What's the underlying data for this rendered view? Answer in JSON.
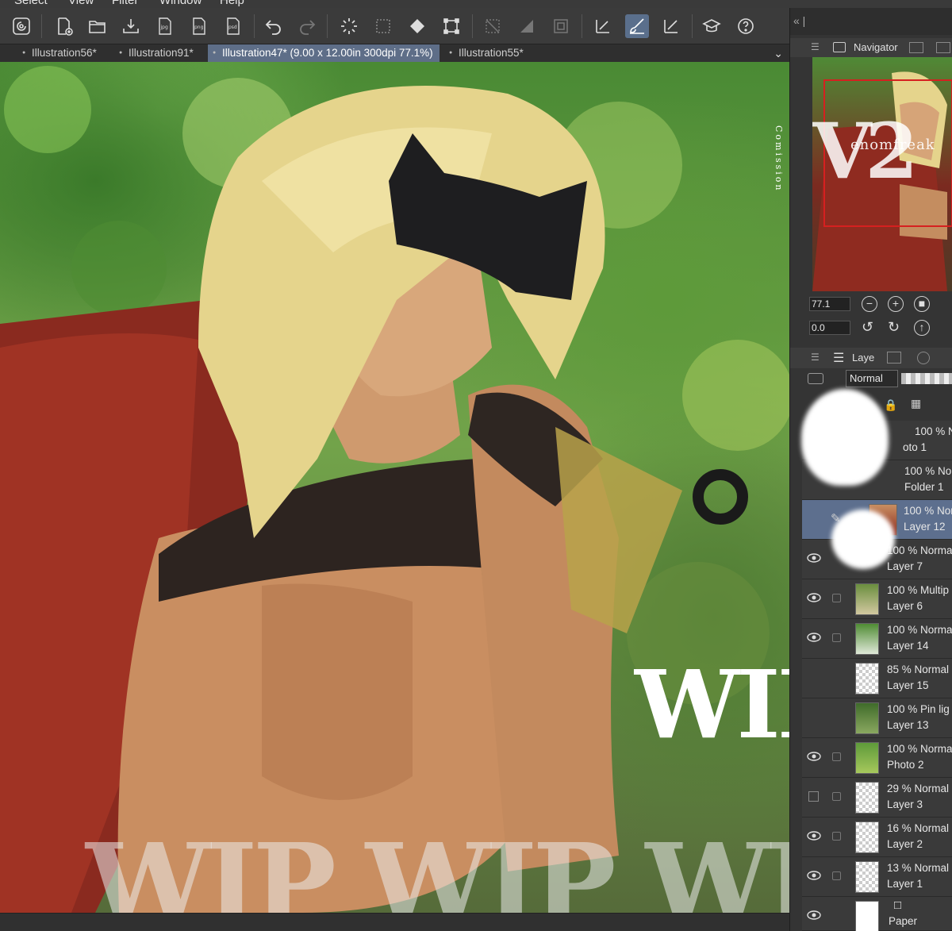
{
  "menu": {
    "items": [
      "Select",
      "View",
      "Filter",
      "Window",
      "Help"
    ]
  },
  "toolbar": {
    "active_tool": "brush-icon"
  },
  "tabs": [
    {
      "label": "Illustration56*"
    },
    {
      "label": "Illustration91*"
    },
    {
      "label": "Illustration47* (9.00 x 12.00in 300dpi 77.1%)"
    },
    {
      "label": "Illustration55*"
    }
  ],
  "canvas": {
    "wip_big": "WIP",
    "wip_row": "WIP WIP WIP",
    "commission_text": "Comission"
  },
  "navigator": {
    "title": "Navigator",
    "zoom": "77.1",
    "rotation": "0.0",
    "watermark_v2": "V2",
    "watermark_name": "enomfreak"
  },
  "layer_panel": {
    "title": "Laye",
    "blend_mode": "Normal"
  },
  "layers": [
    {
      "pct": "100 % N",
      "name": "oto 1"
    },
    {
      "pct": "100 % Nor",
      "name": "Folder 1"
    },
    {
      "pct": "100 % Nor",
      "name": "Layer 12"
    },
    {
      "pct": "100 % Norma",
      "name": "Layer 7"
    },
    {
      "pct": "100 % Multip",
      "name": "Layer 6"
    },
    {
      "pct": "100 % Norma",
      "name": "Layer 14"
    },
    {
      "pct": "85 % Normal",
      "name": "Layer 15"
    },
    {
      "pct": "100 % Pin lig",
      "name": "Layer 13"
    },
    {
      "pct": "100 % Norma",
      "name": "Photo 2"
    },
    {
      "pct": "29 % Normal",
      "name": "Layer 3"
    },
    {
      "pct": "16 % Normal",
      "name": "Layer 2"
    },
    {
      "pct": "13 % Normal",
      "name": "Layer 1"
    },
    {
      "pct": "",
      "name": "Paper"
    }
  ]
}
